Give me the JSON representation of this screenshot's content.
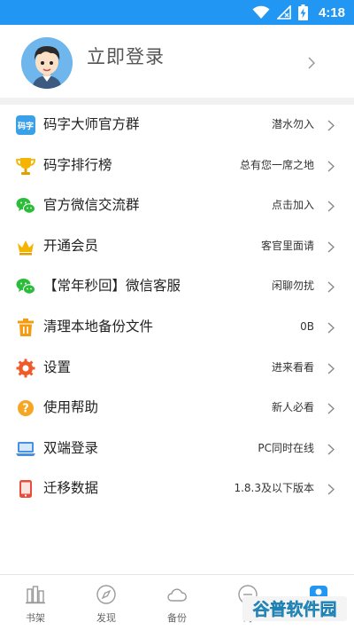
{
  "status_bar": {
    "time": "4:18"
  },
  "profile": {
    "login_label": "立即登录"
  },
  "menu": [
    {
      "icon": "mazi-group-icon",
      "label": "码字大师官方群",
      "value": "潜水勿入"
    },
    {
      "icon": "trophy-icon",
      "label": "码字排行榜",
      "value": "总有您一席之地"
    },
    {
      "icon": "wechat-icon",
      "label": "官方微信交流群",
      "value": "点击加入"
    },
    {
      "icon": "crown-icon",
      "label": "开通会员",
      "value": "客官里面请"
    },
    {
      "icon": "wechat-icon",
      "label": "【常年秒回】微信客服",
      "value": "闲聊勿扰"
    },
    {
      "icon": "trash-icon",
      "label": "清理本地备份文件",
      "value": "0B"
    },
    {
      "icon": "gear-icon",
      "label": "设置",
      "value": "进来看看"
    },
    {
      "icon": "help-icon",
      "label": "使用帮助",
      "value": "新人必看"
    },
    {
      "icon": "laptop-icon",
      "label": "双端登录",
      "value": "PC同时在线"
    },
    {
      "icon": "phone-icon",
      "label": "迁移数据",
      "value": "1.8.3及以下版本"
    }
  ],
  "bottom_nav": [
    {
      "icon": "bookshelf-icon",
      "label": "书架"
    },
    {
      "icon": "compass-icon",
      "label": "发现"
    },
    {
      "icon": "cloud-icon",
      "label": "备份"
    },
    {
      "icon": "mazi-icon",
      "label": "码"
    },
    {
      "icon": "profile-icon",
      "label": ""
    }
  ],
  "watermark": {
    "text": "谷普软件园"
  },
  "colors": {
    "status_bar": "#2196f3",
    "accent": "#2196f3",
    "wechat": "#2bbc3a",
    "gold": "#f4b400",
    "orange": "#f39c12",
    "red": "#e74c3c"
  }
}
